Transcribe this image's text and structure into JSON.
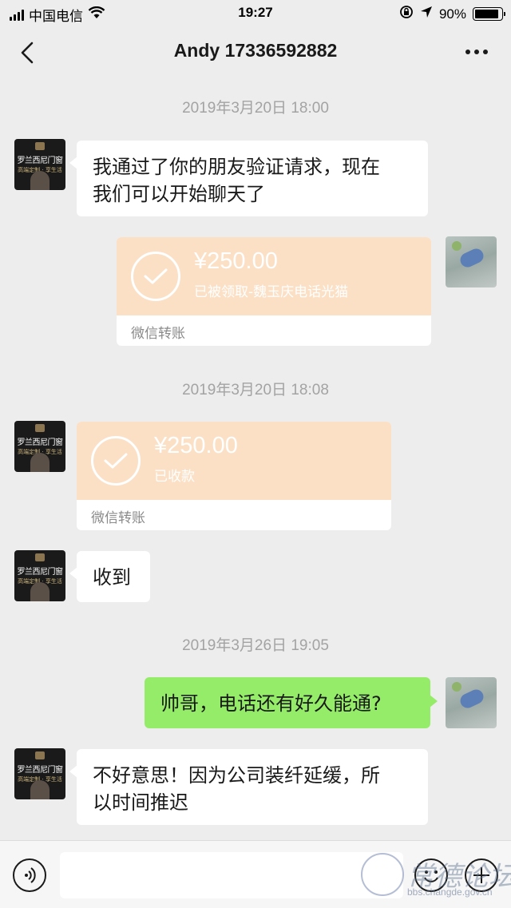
{
  "status_bar": {
    "carrier": "中国电信",
    "time": "19:27",
    "battery_percent": "90%"
  },
  "nav": {
    "title": "Andy 17336592882"
  },
  "messages": [
    {
      "type": "timestamp",
      "text": "2019年3月20日 18:00"
    },
    {
      "type": "text",
      "side": "left",
      "text_line1": "我通过了你的朋友验证请求，现在",
      "text_line2": "我们可以开始聊天了"
    },
    {
      "type": "transfer",
      "side": "right",
      "amount": "¥250.00",
      "note": "已被领取-魏玉庆电话光猫",
      "footer": "微信转账"
    },
    {
      "type": "timestamp",
      "text": "2019年3月20日 18:08"
    },
    {
      "type": "transfer",
      "side": "left",
      "amount": "¥250.00",
      "note": "已收款",
      "footer": "微信转账"
    },
    {
      "type": "text",
      "side": "left",
      "text": "收到"
    },
    {
      "type": "timestamp",
      "text": "2019年3月26日 19:05"
    },
    {
      "type": "text",
      "side": "right",
      "text": "帅哥，电话还有好久能通?"
    },
    {
      "type": "text",
      "side": "left",
      "text_line1": "不好意思！因为公司装纤延缓，所",
      "text_line2": "以时间推迟"
    }
  ],
  "contact_avatar": {
    "brand": "罗兰西尼门窗",
    "sub": "高端定制 · 享生活"
  },
  "watermark": {
    "text": "常德论坛",
    "url": "bbs.changde.gov.cn"
  },
  "colors": {
    "background": "#ededed",
    "sent_bubble": "#95ec69",
    "received_bubble": "#ffffff",
    "transfer_top": "#fbe0c5"
  },
  "icons": [
    "signal-icon",
    "wifi-icon",
    "orientation-lock-icon",
    "location-icon",
    "battery-icon",
    "back-icon",
    "more-icon",
    "voice-icon",
    "emoji-icon",
    "plus-icon"
  ]
}
